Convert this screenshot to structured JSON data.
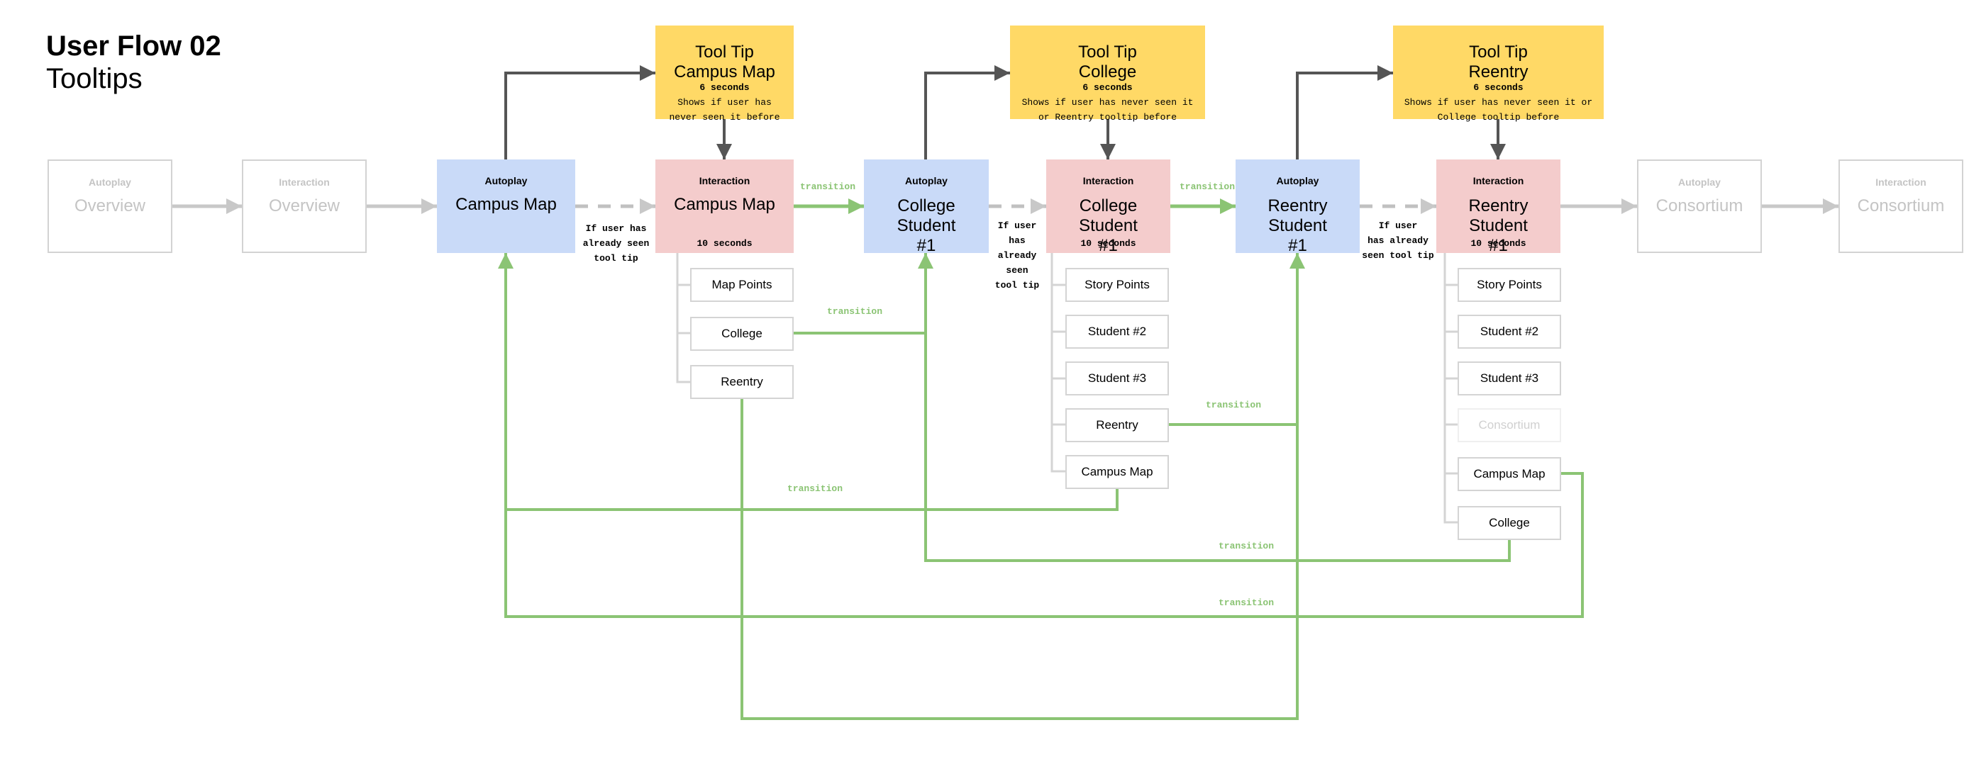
{
  "header": {
    "title": "User Flow 02",
    "subtitle": "Tooltips"
  },
  "colors": {
    "autoplay": "#c9daf8",
    "interaction": "#f4cccc",
    "tooltip": "#ffd966",
    "transition": "#8bc474",
    "connector": "#555555",
    "inactive": "#c4c4c4"
  },
  "nodes": {
    "overview_autoplay": {
      "kind": "Autoplay",
      "name": "Overview"
    },
    "overview_interaction": {
      "kind": "Interaction",
      "name": "Overview"
    },
    "campus_autoplay": {
      "kind": "Autoplay",
      "name": "Campus Map"
    },
    "campus_interaction": {
      "kind": "Interaction",
      "name": "Campus Map",
      "duration": "10 seconds"
    },
    "college_autoplay": {
      "kind": "Autoplay",
      "name": "College Student #1"
    },
    "college_interaction": {
      "kind": "Interaction",
      "name": "College Student #1",
      "duration": "10 seconds"
    },
    "reentry_autoplay": {
      "kind": "Autoplay",
      "name": "Reentry Student #1"
    },
    "reentry_interaction": {
      "kind": "Interaction",
      "name": "Reentry Student #1",
      "duration": "10 seconds"
    },
    "consortium_autoplay": {
      "kind": "Autoplay",
      "name": "Consortium"
    },
    "consortium_interaction": {
      "kind": "Interaction",
      "name": "Consortium"
    }
  },
  "tooltips": {
    "campus": {
      "line1": "Tool Tip",
      "line2": "Campus Map",
      "duration": "6 seconds",
      "condition": "Shows if user has\nnever seen it before"
    },
    "college": {
      "line1": "Tool Tip",
      "line2": "College",
      "duration": "6 seconds",
      "condition": "Shows if user has never seen it\nor Reentry tooltip before"
    },
    "reentry": {
      "line1": "Tool Tip",
      "line2": "Reentry",
      "duration": "6 seconds",
      "condition": "Shows if user has never seen it or\nCollege tooltip before"
    }
  },
  "skip_notes": {
    "campus": "If user has\nalready seen\ntool tip",
    "college": "If user\nhas\nalready\nseen\ntool tip",
    "reentry": "If user\nhas already\nseen tool tip"
  },
  "submenus": {
    "campus": [
      "Map Points",
      "College",
      "Reentry"
    ],
    "college": [
      "Story Points",
      "Student #2",
      "Student #3",
      "Reentry",
      "Campus Map"
    ],
    "reentry": [
      "Story Points",
      "Student #2",
      "Student #3",
      "Consortium",
      "Campus Map",
      "College"
    ]
  },
  "transition_label": "transition"
}
